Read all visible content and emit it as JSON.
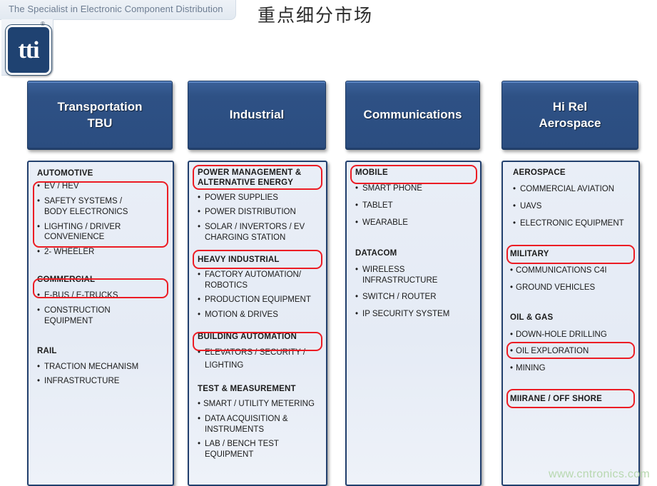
{
  "header": {
    "tagline": "The Specialist in Electronic Component Distribution",
    "logo_text": "tti",
    "logo_registered": "®",
    "title": "重点细分市场"
  },
  "watermark": "www.cntronics.com",
  "colors": {
    "header_blue": "#2e5185",
    "panel_border": "#22406e",
    "panel_bg": "#e8eef7",
    "highlight_red": "#ec1c24",
    "watermark_green": "#b8d8b0"
  },
  "columns": [
    {
      "id": "transportation",
      "title": "Transportation\nTBU",
      "sections": [
        {
          "heading": "AUTOMOTIVE",
          "items": [
            "EV / HEV",
            "SAFETY SYSTEMS /\nBODY ELECTRONICS",
            "LIGHTING / DRIVER\nCONVENIENCE",
            "2- WHEELER"
          ]
        },
        {
          "heading": "COMMERCIAL",
          "items": [
            "E-BUS / E-TRUCKS",
            "CONSTRUCTION\nEQUIPMENT"
          ]
        },
        {
          "heading": "RAIL",
          "items": [
            "TRACTION MECHANISM",
            "INFRASTRUCTURE"
          ]
        }
      ]
    },
    {
      "id": "industrial",
      "title": "Industrial",
      "sections": [
        {
          "heading": "POWER MANAGEMENT &\nALTERNATIVE ENERGY",
          "items": [
            "POWER SUPPLIES",
            "POWER DISTRIBUTION",
            "SOLAR / INVERTORS / EV\nCHARGING STATION"
          ]
        },
        {
          "heading": "HEAVY INDUSTRIAL",
          "items": [
            "FACTORY AUTOMATION/\nROBOTICS",
            "PRODUCTION EQUIPMENT",
            "MOTION & DRIVES"
          ]
        },
        {
          "heading": "BUILDING AUTOMATION",
          "items": [
            "ELEVATORS / SECURITY /\nLIGHTING"
          ]
        },
        {
          "heading": "TEST & MEASUREMENT",
          "items": [
            "SMART /  UTILITY METERING",
            "DATA ACQUISITION &\nINSTRUMENTS",
            "LAB / BENCH TEST\nEQUIPMENT"
          ]
        }
      ]
    },
    {
      "id": "communications",
      "title": "Communications",
      "sections": [
        {
          "heading": "MOBILE",
          "items": [
            "SMART PHONE",
            "TABLET",
            "WEARABLE"
          ]
        },
        {
          "heading": "DATACOM",
          "items": [
            "WIRELESS\nINFRASTRUCTURE",
            "SWITCH / ROUTER",
            "IP SECURITY SYSTEM"
          ]
        }
      ]
    },
    {
      "id": "hi-rel-aerospace",
      "title": "Hi Rel\nAerospace",
      "sections": [
        {
          "heading": "AEROSPACE",
          "items": [
            "COMMERCIAL AVIATION",
            "UAVS",
            "ELECTRONIC EQUIPMENT"
          ]
        },
        {
          "heading": "MILITARY",
          "items": [
            "COMMUNICATIONS C4I",
            "GROUND VEHICLES"
          ]
        },
        {
          "heading": "OIL & GAS",
          "items": [
            "DOWN-HOLE DRILLING",
            "OIL EXPLORATION",
            "MINING"
          ]
        },
        {
          "heading": "MIIRANE / OFF SHORE",
          "items": []
        }
      ]
    }
  ]
}
